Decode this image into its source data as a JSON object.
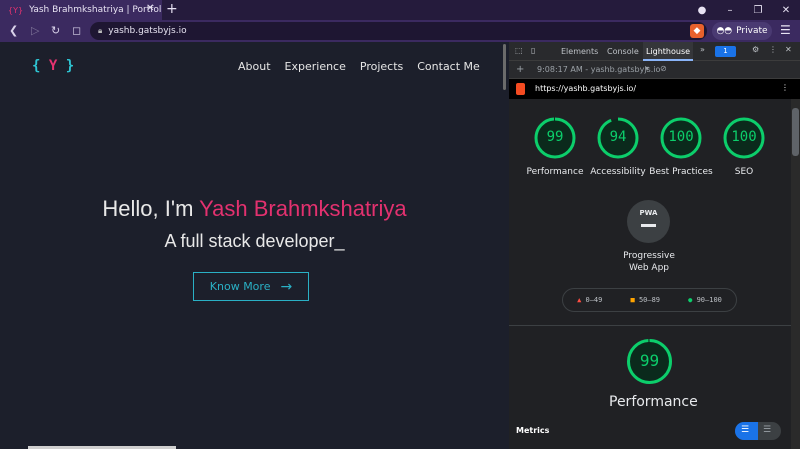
{
  "browser": {
    "tab_title": "Yash Brahmkshatriya | Portfolio",
    "tab_close": "✕",
    "new_tab": "+",
    "url": "yashb.gatsbyjs.io",
    "private_label": "Private",
    "window_controls": [
      "–",
      "❐",
      "✕"
    ]
  },
  "site": {
    "logo_open": "{",
    "logo_letter": "Y",
    "logo_close": "}",
    "nav": [
      "About",
      "Experience",
      "Projects",
      "Contact Me"
    ],
    "hello_prefix": "Hello, I'm ",
    "hello_name": "Yash Brahmkshatriya",
    "subtitle": "A full stack developer_",
    "cta_label": "Know More",
    "cta_arrow": "→"
  },
  "devtools": {
    "tabs": [
      "Elements",
      "Console",
      "Lighthouse"
    ],
    "more": "»",
    "badge": "1",
    "report_time": "9:08:17 AM - yashb.gatsbyjs.io",
    "report_url": "https://yashb.gatsbyjs.io/",
    "scores": [
      {
        "value": "99",
        "label": "Performance",
        "fraction": 0.99
      },
      {
        "value": "94",
        "label": "Accessibility",
        "fraction": 0.94
      },
      {
        "value": "100",
        "label": "Best Practices",
        "fraction": 1.0
      },
      {
        "value": "100",
        "label": "SEO",
        "fraction": 1.0
      }
    ],
    "pwa_text": "PWA",
    "pwa_label": "Progressive Web App",
    "legend": [
      "0–49",
      "50–89",
      "90–100"
    ],
    "big_score": "99",
    "big_score_fraction": 0.99,
    "big_label": "Performance",
    "metrics_label": "Metrics",
    "colors": {
      "pass": "#0cce6b",
      "average": "#ffa400",
      "fail": "#ff4e42"
    }
  }
}
